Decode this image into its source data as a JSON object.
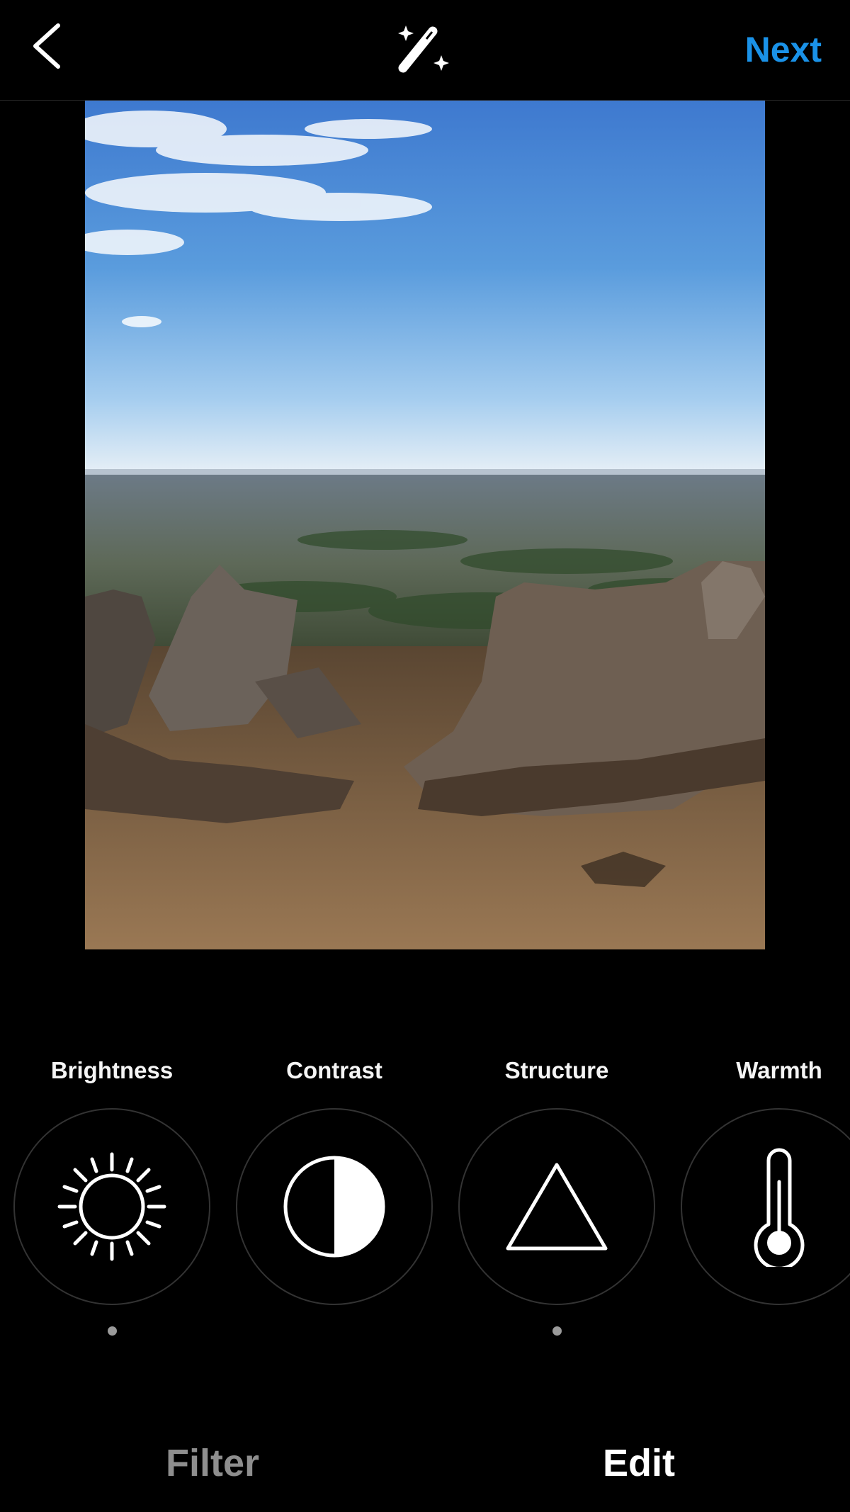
{
  "header": {
    "next_label": "Next",
    "back_icon": "chevron-left-icon",
    "magic_icon": "magic-wand-icon"
  },
  "photo": {
    "subject": "mountaintop-rocks-landscape"
  },
  "tools": [
    {
      "label": "Brightness",
      "icon": "sun-icon",
      "adjusted": true
    },
    {
      "label": "Contrast",
      "icon": "half-circle-icon",
      "adjusted": false
    },
    {
      "label": "Structure",
      "icon": "triangle-icon",
      "adjusted": true
    },
    {
      "label": "Warmth",
      "icon": "thermometer-icon",
      "adjusted": false
    }
  ],
  "tabs": [
    {
      "label": "Filter",
      "active": false
    },
    {
      "label": "Edit",
      "active": true
    }
  ],
  "colors": {
    "accent": "#1a92e8",
    "background": "#000000",
    "inactive_tab": "#8e8e8e",
    "active_tab": "#ffffff",
    "circle_border": "#333333",
    "indicator_dot": "#9a9a9a"
  }
}
